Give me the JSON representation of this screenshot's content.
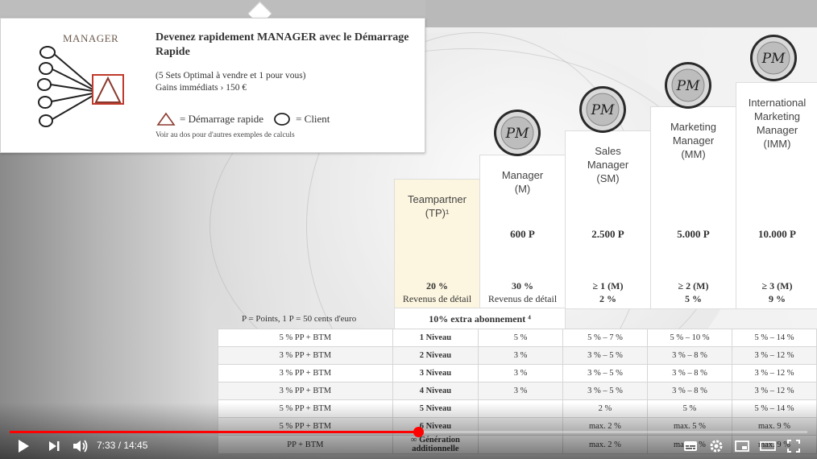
{
  "card": {
    "label": "MANAGER",
    "title": "Devenez rapidement MANAGER avec le Démarrage Rapide",
    "subtitle_line1": "(5 Sets Optimal à vendre et 1 pour vous)",
    "subtitle_line2": "Gains immédiats › 150 €",
    "legend_triangle": "= Démarrage rapide",
    "legend_circle": "= Client",
    "note": "Voir au dos pour d'autres exemples de calculs"
  },
  "columns": [
    {
      "name_lines": [
        "Teampartner",
        "(TP)¹"
      ],
      "points": "",
      "share_line1": "20 %",
      "share_line2": "Revenus de détail",
      "has_logo": false
    },
    {
      "name_lines": [
        "Manager",
        "(M)"
      ],
      "points": "600 P",
      "share_line1": "30 %",
      "share_line2": "Revenus de détail",
      "has_logo": true
    },
    {
      "name_lines": [
        "Sales",
        "Manager",
        "(SM)"
      ],
      "points": "2.500 P",
      "share_line1": "≥ 1 (M)",
      "share_line2": "2 %",
      "has_logo": true
    },
    {
      "name_lines": [
        "Marketing",
        "Manager",
        "(MM)"
      ],
      "points": "5.000 P",
      "share_line1": "≥ 2 (M)",
      "share_line2": "5 %",
      "has_logo": true
    },
    {
      "name_lines": [
        "International",
        "Marketing",
        "Manager",
        "(IMM)"
      ],
      "points": "10.000 P",
      "share_line1": "≥ 3 (M)",
      "share_line2": "9 %",
      "has_logo": true
    }
  ],
  "logo_text": "PM",
  "points_legend": "P = Points, 1 P = 50 cents d'euro",
  "extra_subscription": "10% extra abonnement ⁴",
  "rows": [
    {
      "label": "5 % PP + BTM",
      "level": "1 Niveau",
      "m": "5 %",
      "sm": "5 % – 7 %",
      "mm": "5 % – 10 %",
      "imm": "5 % – 14 %"
    },
    {
      "label": "3 % PP + BTM",
      "level": "2 Niveau",
      "m": "3 %",
      "sm": "3 % – 5 %",
      "mm": "3 % – 8 %",
      "imm": "3 % – 12 %"
    },
    {
      "label": "3 % PP + BTM",
      "level": "3 Niveau",
      "m": "3 %",
      "sm": "3 % – 5 %",
      "mm": "3 % – 8 %",
      "imm": "3 % – 12 %"
    },
    {
      "label": "3 % PP + BTM",
      "level": "4 Niveau",
      "m": "3 %",
      "sm": "3 % – 5 %",
      "mm": "3 % – 8 %",
      "imm": "3 % – 12 %"
    },
    {
      "label": "5 % PP + BTM",
      "level": "5 Niveau",
      "m": "",
      "sm": "2 %",
      "mm": "5 %",
      "imm": "5 % – 14 %"
    },
    {
      "label": "5 % PP + BTM",
      "level": "6 Niveau",
      "m": "",
      "sm": "max. 2 %",
      "mm": "max. 5 %",
      "imm": "max. 9 %"
    },
    {
      "label": "PP + BTM",
      "level": "∞ Génération additionnelle",
      "m": "",
      "sm": "max. 2 %",
      "mm": "max. 5 %",
      "imm": "max. 9 %"
    }
  ],
  "player": {
    "current_time": "7:33",
    "duration": "14:45",
    "progress": 0.512,
    "accent": "#ff0000"
  }
}
